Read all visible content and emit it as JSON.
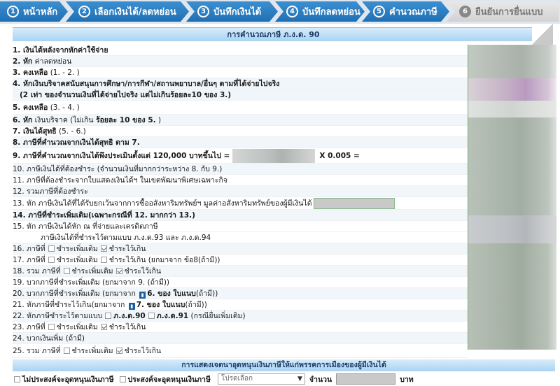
{
  "steps": [
    {
      "num": "1",
      "label": "หน้าหลัก",
      "state": "active"
    },
    {
      "num": "2",
      "label": "เลือกเงินได้/ลดหย่อน",
      "state": "active"
    },
    {
      "num": "3",
      "label": "บันทึกเงินได้",
      "state": "active"
    },
    {
      "num": "4",
      "label": "บันทึกลดหย่อน",
      "state": "active"
    },
    {
      "num": "5",
      "label": "คำนวณภาษี",
      "state": "active"
    },
    {
      "num": "6",
      "label": "ยืนยันการยื่นแบบ",
      "state": "disabled"
    }
  ],
  "section_title": "การคำนวณภาษี ภ.ง.ด. 90",
  "rows": {
    "r1": "1. เงินได้หลังจากหักค่าใช้จ่าย",
    "r2_head": "2. หัก",
    "r2_rest": " ค่าลดหย่อน",
    "r3_head": "3. คงเหลือ",
    "r3_rest": " (1. - 2. )",
    "r4a": "4. หักเงินบริจาคสนับสนุนการศึกษา/การกีฬา/สถานพยาบาล/อื่นๆ ตามที่ได้จ่ายไปจริง",
    "r4b": "(2 เท่า ของจำนวนเงินที่ได้จ่ายไปจริง แต่ไม่เกินร้อยละ10 ของ 3.)",
    "r5_head": "5. คงเหลือ",
    "r5_rest": " (3. - 4. )",
    "r6_head": "6. หัก",
    "r6_mid": " เงินบริจาค (ไม่เกิน ",
    "r6_bold": "ร้อยละ 10 ของ 5.",
    "r6_tail": " )",
    "r7_head": "7. เงินได้สุทธิ",
    "r7_rest": " (5. - 6.)",
    "r8": "8. ภาษีที่คำนวณจากเงินได้สุทธิ ตาม 7.",
    "r9": "9. ภาษีที่คำนวณจากเงินได้พึงประเมินตั้งแต่ 120,000 บาทขึ้นไป =",
    "r9_tail": "X 0.005 =",
    "r10": "10. ภาษีเงินได้ที่ต้องชำระ (จำนวนเงินที่มากกว่าระหว่าง 8. กับ 9.)",
    "r11": "11. ภาษีที่ต้องชำระจากใบแสดงเงินได้ฯ ในเขตพัฒนาพิเศษเฉพาะกิจ",
    "r12": "12. รวมภาษีที่ต้องชำระ",
    "r13_head": "13. หัก",
    "r13_rest": " ภาษีเงินได้ที่ได้รับยกเว้นจากการซื้ออสังหาริมทรัพย์ฯ มูลค่าอสังหาริมทรัพย์ของผู้มีเงินได้",
    "r14_head": "14. ภาษีที่ชำระเพิ่มเติม",
    "r14_rest": "(เฉพาะกรณีที่ 12. มากกว่า 13.)",
    "r15": "15. หัก ภาษีเงินได้หัก ณ ที่จ่ายและเครดิตภาษี",
    "r15b": "ภาษีเงินได้ที่ชำระไว้ตามแบบ ภ.ง.ด.93 และ ภ.ง.ด.94",
    "r16_head": "16. ภาษีที่",
    "r17_head": "17. ภาษีที่",
    "r17_tail": " (ยกมาจาก ข้อ8(ถ้ามี))",
    "r18_head": "18. รวม ภาษีที่",
    "r19_head": "19. บวกภาษีที่ชำระเพิ่มเติม",
    "r19_rest": " (ยกมาจาก 9. (ถ้ามี))",
    "r20_head": "20. บวกภาษีที่ชำระเพิ่มเติม",
    "r20_mid": " (ยกมาจาก ",
    "r20_b": "6. ของ ใบแนบ",
    "r20_tail": "(ถ้ามี))",
    "r21_head": "21. หักภาษีที่ชำระไว้เกิน",
    "r21_mid": "(ยกมาจาก ",
    "r21_b": "7. ของ ใบแนบ",
    "r21_tail": "(ถ้ามี))",
    "r22_head": "22. หักภาษีชำระไว้ตามแบบ",
    "r22_a": "ภ.ง.ด.90",
    "r22_b": "ภ.ง.ด.91",
    "r22_tail": " (กรณียื่นเพิ่มเติม)",
    "r23_head": "23. ภาษีที่",
    "r24": "24. บวกเงินเพิ่ม (ถ้ามี)",
    "r25_head": "25. รวม ภาษีที่",
    "opt_extra": "ชำระเพิ่มเติม",
    "opt_over": "ชำระไว้เกิน",
    "attach_icon": "attachment-icon"
  },
  "checks": {
    "r16": [
      false,
      true
    ],
    "r17": [
      false,
      false
    ],
    "r18": [
      false,
      true
    ],
    "r23": [
      false,
      true
    ],
    "r25": [
      false,
      true
    ]
  },
  "bottom": {
    "title": "การแสดงเจตนาอุดหนุนเงินภาษีให้แก่พรรคการเมืองของผู้มีเงินได้",
    "no_support": "ไม่ประสงค์จะอุดหนุนเงินภาษี",
    "support": "ประสงค์จะอุดหนุนเงินภาษี",
    "select_placeholder": "โปรดเลือก",
    "amount_label": "จำนวน",
    "unit": "บาท"
  }
}
